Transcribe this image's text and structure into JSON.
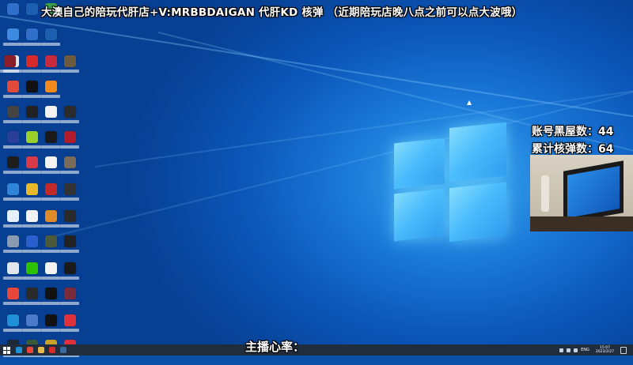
{
  "overlay": {
    "title": "大澳自己的陪玩代肝店+V:MRBBDAIGAN 代肝KD 核弹 （近期陪玩店晚八点之前可以点大波哦）",
    "stat_banned_label": "账号黑屋数：44",
    "stat_nuke_label": "累计核弹数：64",
    "heart_rate_label": "主播心率："
  },
  "desktop": {
    "icons": [
      {
        "name": "this-pc",
        "color": "#3d8be0"
      },
      {
        "name": "app-blue",
        "color": "#2f6fc9"
      },
      {
        "name": "app-blue-2",
        "color": "#1c5fb0"
      },
      {
        "name": "file-doc",
        "color": "#e8e8e8"
      },
      {
        "name": "netease-music",
        "color": "#d82a2a"
      },
      {
        "name": "app-red",
        "color": "#c7293d"
      },
      {
        "name": "game-1",
        "color": "#6d5b3f"
      },
      {
        "name": "game-2",
        "color": "#8a1f2b"
      },
      {
        "name": "app-colorful",
        "color": "#e04a3a"
      },
      {
        "name": "capcut",
        "color": "#111111"
      },
      {
        "name": "app-orange",
        "color": "#f28a1c"
      },
      {
        "name": "game-3",
        "color": "#444444"
      },
      {
        "name": "clock-app",
        "color": "#222222"
      },
      {
        "name": "doc-white",
        "color": "#f2f2f2"
      },
      {
        "name": "game-4",
        "color": "#2b2b2b"
      },
      {
        "name": "app-blue-3",
        "color": "#2a3f9a"
      },
      {
        "name": "game-green",
        "color": "#9ad12a"
      },
      {
        "name": "game-dark",
        "color": "#1a1a1a"
      },
      {
        "name": "game-red",
        "color": "#b01c2a"
      },
      {
        "name": "qq",
        "color": "#1d1d1d"
      },
      {
        "name": "app-red-2",
        "color": "#d83a4a"
      },
      {
        "name": "doc-white-2",
        "color": "#f2f2f2"
      },
      {
        "name": "game-5",
        "color": "#7a6a5a"
      },
      {
        "name": "app-cloud",
        "color": "#2f86d8"
      },
      {
        "name": "game-owl",
        "color": "#e9b82a"
      },
      {
        "name": "game-6",
        "color": "#c22a2a"
      },
      {
        "name": "game-7",
        "color": "#333333"
      },
      {
        "name": "app-light",
        "color": "#e6f0fb"
      },
      {
        "name": "doc-white-3",
        "color": "#f2f2f2"
      },
      {
        "name": "game-question",
        "color": "#e08a2a"
      },
      {
        "name": "game-8",
        "color": "#2a2a2a"
      },
      {
        "name": "app-gray",
        "color": "#8a9bb0"
      },
      {
        "name": "app-blue-4",
        "color": "#2a5fcf"
      },
      {
        "name": "game-9",
        "color": "#4a5a3a"
      },
      {
        "name": "mw-game",
        "color": "#222222"
      },
      {
        "name": "app-light-2",
        "color": "#dfe6ee"
      },
      {
        "name": "wechat",
        "color": "#2dc100"
      },
      {
        "name": "doc-white-4",
        "color": "#f2f2f2"
      },
      {
        "name": "logitech",
        "color": "#1a1a1a"
      },
      {
        "name": "chrome",
        "color": "#e7463a"
      },
      {
        "name": "app-dark-2",
        "color": "#2a2a2a"
      },
      {
        "name": "app-black",
        "color": "#111111"
      },
      {
        "name": "game-10",
        "color": "#7a2a3a"
      },
      {
        "name": "edge",
        "color": "#1f8fd6"
      },
      {
        "name": "app-blue-5",
        "color": "#4a7ac9"
      },
      {
        "name": "app-black-2",
        "color": "#111111"
      },
      {
        "name": "app-red-3",
        "color": "#e0303a"
      },
      {
        "name": "steam",
        "color": "#1b2838"
      },
      {
        "name": "game-11",
        "color": "#3a5a3a"
      },
      {
        "name": "game-yellow",
        "color": "#c9a12a"
      },
      {
        "name": "app-red-4",
        "color": "#e0303a"
      }
    ]
  },
  "webcam": {
    "label": "streamer-webcam"
  },
  "taskbar": {
    "apps": [
      {
        "name": "edge-icon",
        "color": "#1f8fd6"
      },
      {
        "name": "chrome-icon",
        "color": "#e7463a"
      },
      {
        "name": "explorer-icon",
        "color": "#e8b84a"
      },
      {
        "name": "app-red-icon",
        "color": "#d82a2a"
      },
      {
        "name": "steam-icon",
        "color": "#3a6aa0"
      }
    ],
    "time": "15:07",
    "date": "2023/2/27"
  }
}
